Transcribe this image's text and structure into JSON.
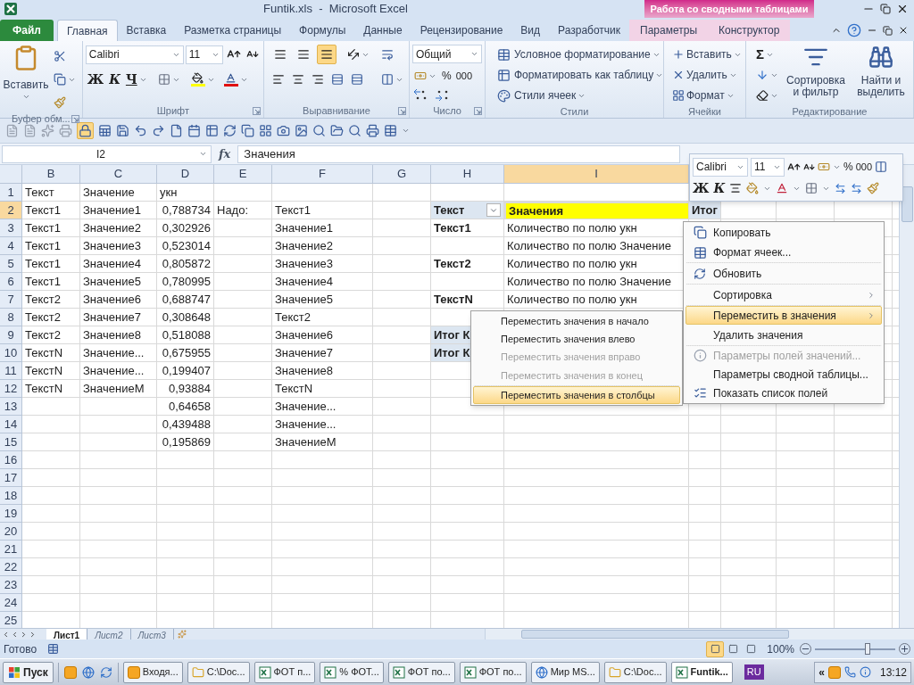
{
  "window": {
    "title": "Funtik.xls  -  Microsoft Excel",
    "context_group": "Работа со сводными таблицами"
  },
  "tabs": [
    {
      "label": "Файл",
      "kind": "file",
      "selected": false
    },
    {
      "label": "Главная",
      "kind": "tab",
      "selected": true
    },
    {
      "label": "Вставка",
      "kind": "tab",
      "selected": false
    },
    {
      "label": "Разметка страницы",
      "kind": "tab",
      "selected": false
    },
    {
      "label": "Формулы",
      "kind": "tab",
      "selected": false
    },
    {
      "label": "Данные",
      "kind": "tab",
      "selected": false
    },
    {
      "label": "Рецензирование",
      "kind": "tab",
      "selected": false
    },
    {
      "label": "Вид",
      "kind": "tab",
      "selected": false
    },
    {
      "label": "Разработчик",
      "kind": "tab",
      "selected": false
    },
    {
      "label": "Параметры",
      "kind": "context",
      "selected": false
    },
    {
      "label": "Конструктор",
      "kind": "context",
      "selected": false
    }
  ],
  "ribbon": {
    "groups": [
      {
        "kind": "clipboard",
        "label": "Буфер обм...",
        "launcher": true,
        "paste": "Вставить"
      },
      {
        "kind": "font",
        "label": "Шрифт",
        "launcher": true,
        "font": "Calibri",
        "size": "11",
        "bold": "Ж",
        "italic": "К",
        "underline": "Ч"
      },
      {
        "kind": "alignment",
        "label": "Выравнивание",
        "launcher": true,
        "vertical": [
          {
            "selected": false
          },
          {
            "selected": false
          },
          {
            "selected": true
          }
        ]
      },
      {
        "kind": "number",
        "label": "Число",
        "launcher": true,
        "format": "Общий",
        "percent": "%",
        "thousands": "000"
      },
      {
        "kind": "styles",
        "label": "Стили",
        "launcher": false,
        "items": [
          "Условное форматирование",
          "Форматировать как таблицу",
          "Стили ячеек"
        ]
      },
      {
        "kind": "cells",
        "label": "Ячейки",
        "launcher": false,
        "items": [
          "Вставить",
          "Удалить",
          "Формат"
        ]
      },
      {
        "kind": "editing",
        "label": "Редактирование",
        "launcher": false,
        "sum": "Σ",
        "items": [
          "Сортировка и фильтр",
          "Найти и выделить"
        ]
      }
    ]
  },
  "formula_bar": {
    "name_box": "I2",
    "function_label": "fx",
    "value": "Значения"
  },
  "grid": {
    "columns": [
      {
        "label": "B",
        "selected": false
      },
      {
        "label": "C",
        "selected": false
      },
      {
        "label": "D",
        "selected": false
      },
      {
        "label": "E",
        "selected": false
      },
      {
        "label": "F",
        "selected": false
      },
      {
        "label": "G",
        "selected": false
      },
      {
        "label": "H",
        "selected": false
      },
      {
        "label": "I",
        "selected": true
      }
    ],
    "rows": [
      {
        "number": "1",
        "selected": false,
        "cells": [
          "Текст",
          "Значение",
          "укн",
          null,
          null,
          null,
          null,
          null,
          null
        ]
      },
      {
        "number": "2",
        "selected": true,
        "cells": [
          "Текст1",
          "Значение1",
          {
            "text": "0,788734",
            "kind": "number"
          },
          "Надо:",
          "Текст1",
          null,
          {
            "text": "Текст",
            "kind": "pivot-header",
            "filter": true
          },
          {
            "text": "Значения",
            "kind": "active-header"
          },
          {
            "text": "Итог",
            "kind": "pivot-header",
            "filter": false
          }
        ]
      },
      {
        "number": "3",
        "selected": false,
        "cells": [
          "Текст1",
          "Значение2",
          {
            "text": "0,302926",
            "kind": "number"
          },
          null,
          "Значение1",
          null,
          {
            "text": "Текст1",
            "kind": "pivot-row"
          },
          "Количество по полю укн",
          null
        ]
      },
      {
        "number": "4",
        "selected": false,
        "cells": [
          "Текст1",
          "Значение3",
          {
            "text": "0,523014",
            "kind": "number"
          },
          null,
          "Значение2",
          null,
          null,
          "Количество по полю Значение",
          null
        ]
      },
      {
        "number": "5",
        "selected": false,
        "cells": [
          "Текст1",
          "Значение4",
          {
            "text": "0,805872",
            "kind": "number"
          },
          null,
          "Значение3",
          null,
          {
            "text": "Текст2",
            "kind": "pivot-row"
          },
          "Количество по полю укн",
          null
        ]
      },
      {
        "number": "6",
        "selected": false,
        "cells": [
          "Текст1",
          "Значение5",
          {
            "text": "0,780995",
            "kind": "number"
          },
          null,
          "Значение4",
          null,
          null,
          "Количество по полю Значение",
          null
        ]
      },
      {
        "number": "7",
        "selected": false,
        "cells": [
          "Текст2",
          "Значение6",
          {
            "text": "0,688747",
            "kind": "number"
          },
          null,
          "Значение5",
          null,
          {
            "text": "ТекстN",
            "kind": "pivot-row"
          },
          "Количество по полю укн",
          null
        ]
      },
      {
        "number": "8",
        "selected": false,
        "cells": [
          "Текст2",
          "Значение7",
          {
            "text": "0,308648",
            "kind": "number"
          },
          null,
          "Текст2",
          null,
          null,
          null,
          null
        ]
      },
      {
        "number": "9",
        "selected": false,
        "cells": [
          "Текст2",
          "Значение8",
          {
            "text": "0,518088",
            "kind": "number"
          },
          null,
          "Значение6",
          null,
          {
            "text": "Итог К",
            "kind": "pivot-total"
          },
          null,
          null
        ]
      },
      {
        "number": "10",
        "selected": false,
        "cells": [
          "ТекстN",
          "Значение...",
          {
            "text": "0,675955",
            "kind": "number"
          },
          null,
          "Значение7",
          null,
          {
            "text": "Итог К",
            "kind": "pivot-total"
          },
          null,
          null
        ]
      },
      {
        "number": "11",
        "selected": false,
        "cells": [
          "ТекстN",
          "Значение...",
          {
            "text": "0,199407",
            "kind": "number"
          },
          null,
          "Значение8",
          null,
          null,
          null,
          null
        ]
      },
      {
        "number": "12",
        "selected": false,
        "cells": [
          "ТекстN",
          "ЗначениеM",
          {
            "text": "0,93884",
            "kind": "number"
          },
          null,
          "ТекстN",
          null,
          null,
          null,
          null
        ]
      },
      {
        "number": "13",
        "selected": false,
        "cells": [
          null,
          null,
          {
            "text": "0,64658",
            "kind": "number"
          },
          null,
          "Значение...",
          null,
          null,
          null,
          null
        ]
      },
      {
        "number": "14",
        "selected": false,
        "cells": [
          null,
          null,
          {
            "text": "0,439488",
            "kind": "number"
          },
          null,
          "Значение...",
          null,
          null,
          null,
          null
        ]
      },
      {
        "number": "15",
        "selected": false,
        "cells": [
          null,
          null,
          {
            "text": "0,195869",
            "kind": "number"
          },
          null,
          "ЗначениеM",
          null,
          null,
          null,
          null
        ]
      },
      {
        "number": "16",
        "selected": false
      },
      {
        "number": "17",
        "selected": false
      },
      {
        "number": "18",
        "selected": false
      },
      {
        "number": "19",
        "selected": false
      },
      {
        "number": "20",
        "selected": false
      },
      {
        "number": "21",
        "selected": false
      },
      {
        "number": "22",
        "selected": false
      },
      {
        "number": "23",
        "selected": false
      },
      {
        "number": "24",
        "selected": false
      },
      {
        "number": "25",
        "selected": false
      }
    ]
  },
  "mini_toolbar": {
    "font": "Calibri",
    "size": "11",
    "percent": "%",
    "thousands": "000",
    "bold": "Ж",
    "italic": "К"
  },
  "context_menu": {
    "items": [
      {
        "label": "Копировать",
        "kind": "copy",
        "selected": false,
        "disabled": false,
        "submenu": false,
        "separator_after": false
      },
      {
        "label": "Формат ячеек...",
        "kind": "format",
        "selected": false,
        "disabled": false,
        "submenu": false,
        "separator_after": true
      },
      {
        "label": "Обновить",
        "kind": "refresh",
        "selected": false,
        "disabled": false,
        "submenu": false,
        "separator_after": true
      },
      {
        "label": "Сортировка",
        "kind": "plain",
        "selected": false,
        "disabled": false,
        "submenu": true,
        "separator_after": true
      },
      {
        "label": "Переместить в значения",
        "kind": "plain",
        "selected": true,
        "disabled": false,
        "submenu": true,
        "separator_after": false
      },
      {
        "label": "Удалить значения",
        "kind": "plain",
        "selected": false,
        "disabled": false,
        "submenu": false,
        "separator_after": true
      },
      {
        "label": "Параметры полей значений...",
        "kind": "field-settings",
        "selected": false,
        "disabled": true,
        "submenu": false,
        "separator_after": false
      },
      {
        "label": "Параметры сводной таблицы...",
        "kind": "plain",
        "selected": false,
        "disabled": false,
        "submenu": false,
        "separator_after": false
      },
      {
        "label": "Показать список полей",
        "kind": "field-list",
        "selected": false,
        "disabled": false,
        "submenu": false,
        "separator_after": false
      }
    ]
  },
  "submenu": {
    "items": [
      {
        "label": "Переместить значения в начало",
        "selected": false,
        "disabled": false,
        "separator_after": false
      },
      {
        "label": "Переместить значения влево",
        "selected": false,
        "disabled": false,
        "separator_after": false
      },
      {
        "label": "Переместить значения вправо",
        "selected": false,
        "disabled": true,
        "separator_after": false
      },
      {
        "label": "Переместить значения в конец",
        "selected": false,
        "disabled": true,
        "separator_after": true
      },
      {
        "label": "Переместить значения в столбцы",
        "selected": true,
        "disabled": false,
        "separator_after": false
      }
    ]
  },
  "sheet_tabs": [
    {
      "label": "Лист1",
      "selected": true
    },
    {
      "label": "Лист2",
      "selected": false
    },
    {
      "label": "Лист3",
      "selected": false
    }
  ],
  "status_bar": {
    "status": "Готово",
    "views": [
      {
        "selected": true
      },
      {
        "selected": false
      },
      {
        "selected": false
      }
    ],
    "zoom": "100%",
    "zoom_slider": {
      "level": 0.66
    }
  },
  "taskbar": {
    "start": "Пуск",
    "quick_launch": [
      {
        "kind": "mail"
      },
      {
        "kind": "browser"
      },
      {
        "kind": "browser-alt"
      }
    ],
    "tasks": [
      {
        "label": "Входя...",
        "kind": "mail",
        "selected": false
      },
      {
        "label": "C:\\Doc...",
        "kind": "folder",
        "selected": false
      },
      {
        "label": "ФОТ п...",
        "kind": "sheet",
        "selected": false
      },
      {
        "label": "% ФОТ...",
        "kind": "sheet",
        "selected": false
      },
      {
        "label": "ФОТ по...",
        "kind": "sheet",
        "selected": false
      },
      {
        "label": "ФОТ по...",
        "kind": "sheet",
        "selected": false
      },
      {
        "label": "Мир MS...",
        "kind": "browser",
        "selected": false
      },
      {
        "label": "C:\\Doc...",
        "kind": "folder",
        "selected": false
      },
      {
        "label": "Funtik...",
        "kind": "sheet",
        "selected": true
      }
    ],
    "language": "RU",
    "tray_toggle": "«",
    "clock": "13:12"
  }
}
